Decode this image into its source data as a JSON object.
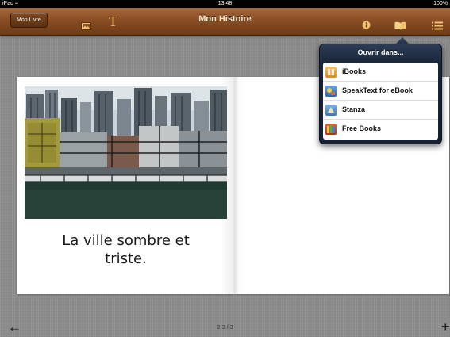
{
  "status_bar": {
    "carrier": "iPad ≈",
    "time": "13:48",
    "battery": "100%"
  },
  "toolbar": {
    "book_button_label": "Mon Livre",
    "title": "Mon Histoire",
    "text_tool_glyph": "T",
    "icons": [
      "photo-icon",
      "text-icon",
      "info-icon",
      "book-icon",
      "list-icon"
    ]
  },
  "page": {
    "caption": "La ville sombre et\ntriste."
  },
  "popover": {
    "title": "Ouvrir dans...",
    "items": [
      {
        "label": "iBooks",
        "icon": "ibooks-icon",
        "color": "#e9a233"
      },
      {
        "label": "SpeakText for eBook",
        "icon": "speaktext-icon",
        "color": "#3a78c8"
      },
      {
        "label": "Stanza",
        "icon": "stanza-icon",
        "color": "#4c88c9"
      },
      {
        "label": "Free Books",
        "icon": "free-books-icon",
        "color": "#c44a21"
      }
    ]
  },
  "footer": {
    "page_indicator": "2-3 / 3",
    "back_glyph": "←",
    "add_glyph": "+"
  },
  "colors": {
    "toolbar": "#8a4e24",
    "popover": "#1a2638",
    "background": "#8e8e8e"
  }
}
